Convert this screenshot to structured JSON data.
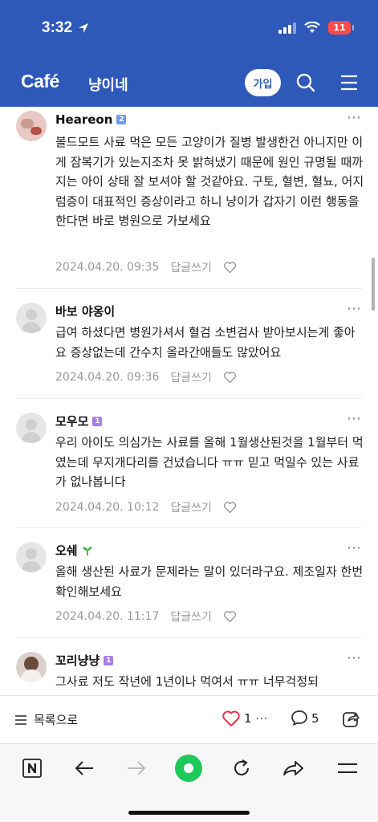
{
  "status_bar": {
    "time": "3:32",
    "battery": "11"
  },
  "header": {
    "logo": "Café",
    "cafe_name": "냥이네",
    "join_label": "가입"
  },
  "comments": [
    {
      "author": "Heareon",
      "badge": "2",
      "text": "볼드모트 사료 먹은 모든 고양이가 질병 발생한건 아니지만 이게 잠복기가 있는지조차 못 밝혀냈기 때문에 원인 규명될 때까지는 아이 상태 잘 보셔야 할 것같아요. 구토, 혈변, 혈뇨, 어지럼증이 대표적인 증상이라고 하니 냥이가 갑자기 이런 행동을 한다면 바로 병원으로 가보세요",
      "date": "2024.04.20. 09:35",
      "reply": "답글쓰기"
    },
    {
      "author": "바보 야옹이",
      "badge": "",
      "text": "급여 하셨다면 병원가셔서 혈검 소변검사 받아보시는게 좋아요 증상없는데 간수치 올라간애들도 많았어요",
      "date": "2024.04.20. 09:36",
      "reply": "답글쓰기"
    },
    {
      "author": "모우모",
      "badge": "1",
      "text": "우리 아이도 의심가는 사료를 올해 1월생산된것을 1월부터 먹였는데 무지개다리를 건넜습니다 ㅠㅠ 믿고 먹일수 있는 사료가 없나봅니다",
      "date": "2024.04.20. 10:12",
      "reply": "답글쓰기"
    },
    {
      "author": "오쉐",
      "badge": "",
      "text": "올해 생산된 사료가 문제라는 말이 있더라구요. 제조일자 한번 확인해보세요",
      "date": "2024.04.20. 11:17",
      "reply": "답글쓰기"
    },
    {
      "author": "꼬리냥냥",
      "badge": "1",
      "text": "그사료 저도 작년에 1년이나 먹여서 ㅠㅠ 너무걱정되",
      "date": "",
      "reply": ""
    }
  ],
  "action_bar": {
    "list_label": "목록으로",
    "like_count": "1",
    "comment_count": "5"
  },
  "colors": {
    "brand": "#2f59b8",
    "heart": "#e8344e",
    "badge_level2": "#6f9bf0",
    "badge_level1": "#a87ee8",
    "browser_green": "#1ec95a"
  },
  "icons": {
    "header": [
      "search-icon",
      "menu-icon"
    ],
    "action_bar": [
      "list-icon",
      "heart-icon",
      "more-icon",
      "comment-icon",
      "share-icon"
    ],
    "browser": [
      "naver-n-icon",
      "back-arrow-icon",
      "forward-arrow-icon",
      "green-dot-icon",
      "refresh-icon",
      "share-arrow-icon",
      "menu-icon"
    ]
  }
}
